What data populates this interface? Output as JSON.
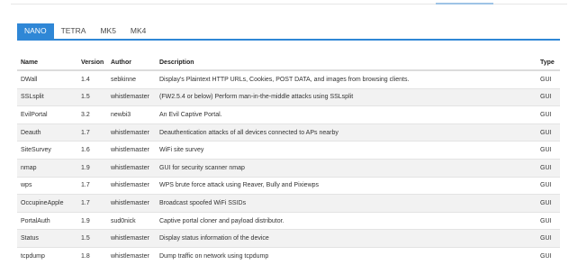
{
  "tabs": [
    {
      "label": "NANO",
      "active": true
    },
    {
      "label": "TETRA",
      "active": false
    },
    {
      "label": "MK5",
      "active": false
    },
    {
      "label": "MK4",
      "active": false
    }
  ],
  "table": {
    "headers": [
      "Name",
      "Version",
      "Author",
      "Description",
      "Type"
    ],
    "rows": [
      [
        "DWall",
        "1.4",
        "sebkinne",
        "Display's Plaintext HTTP URLs, Cookies, POST DATA, and images from browsing clients.",
        "GUI"
      ],
      [
        "SSLsplit",
        "1.5",
        "whistlemaster",
        "(FW2.5.4 or below) Perform man-in-the-middle attacks using SSLsplit",
        "GUI"
      ],
      [
        "EvilPortal",
        "3.2",
        "newbi3",
        "An Evil Captive Portal.",
        "GUI"
      ],
      [
        "Deauth",
        "1.7",
        "whistlemaster",
        "Deauthentication attacks of all devices connected to APs nearby",
        "GUI"
      ],
      [
        "SiteSurvey",
        "1.6",
        "whistlemaster",
        "WiFi site survey",
        "GUI"
      ],
      [
        "nmap",
        "1.9",
        "whistlemaster",
        "GUI for security scanner nmap",
        "GUI"
      ],
      [
        "wps",
        "1.7",
        "whistlemaster",
        "WPS brute force attack using Reaver, Bully and Pixiewps",
        "GUI"
      ],
      [
        "OccupineApple",
        "1.7",
        "whistlemaster",
        "Broadcast spoofed WiFi SSIDs",
        "GUI"
      ],
      [
        "PortalAuth",
        "1.9",
        "sud0nick",
        "Captive portal cloner and payload distributor.",
        "GUI"
      ],
      [
        "Status",
        "1.5",
        "whistlemaster",
        "Display status information of the device",
        "GUI"
      ],
      [
        "tcpdump",
        "1.8",
        "whistlemaster",
        "Dump traffic on network using tcpdump",
        "GUI"
      ]
    ]
  }
}
